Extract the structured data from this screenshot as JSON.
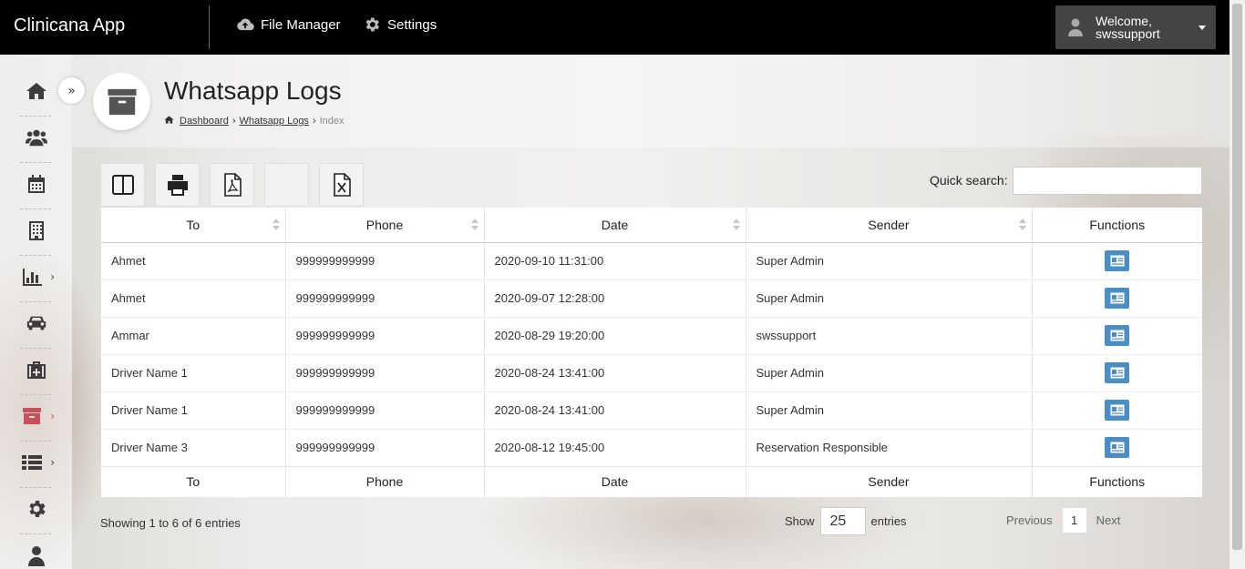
{
  "app": {
    "brand": "Clinicana App"
  },
  "topnav": [
    {
      "label": "File Manager",
      "icon": "cloud-upload-icon"
    },
    {
      "label": "Settings",
      "icon": "gear-icon"
    }
  ],
  "user": {
    "welcome": "Welcome,",
    "name": "swssupport"
  },
  "sidebar": {
    "items": [
      {
        "icon": "home-icon"
      },
      {
        "icon": "users-icon"
      },
      {
        "icon": "calendar-icon"
      },
      {
        "icon": "building-icon"
      },
      {
        "icon": "bar-chart-icon",
        "has_submenu": true
      },
      {
        "icon": "car-icon"
      },
      {
        "icon": "medkit-icon"
      },
      {
        "icon": "archive-icon",
        "has_submenu": true,
        "active": true
      },
      {
        "icon": "list-icon",
        "has_submenu": true
      },
      {
        "icon": "gear-icon"
      },
      {
        "icon": "user-icon"
      }
    ]
  },
  "page": {
    "title": "Whatsapp Logs",
    "breadcrumb": [
      {
        "label": "Dashboard",
        "link": true
      },
      {
        "label": "Whatsapp Logs",
        "link": true
      },
      {
        "label": "Index",
        "link": false
      }
    ],
    "separator": "›"
  },
  "toolbar": {
    "buttons": [
      "columns-icon",
      "print-icon",
      "pdf-icon",
      "blank",
      "excel-icon"
    ],
    "search_label": "Quick search:",
    "search_value": ""
  },
  "table": {
    "columns": [
      "To",
      "Phone",
      "Date",
      "Sender",
      "Functions"
    ],
    "rows": [
      {
        "to": "Ahmet",
        "phone": "999999999999",
        "date": "2020-09-10 11:31:00",
        "sender": "Super Admin"
      },
      {
        "to": "Ahmet",
        "phone": "999999999999",
        "date": "2020-09-07 12:28:00",
        "sender": "Super Admin"
      },
      {
        "to": "Ammar",
        "phone": "999999999999",
        "date": "2020-08-29 19:20:00",
        "sender": "swssupport"
      },
      {
        "to": "Driver Name 1",
        "phone": "999999999999",
        "date": "2020-08-24 13:41:00",
        "sender": "Super Admin"
      },
      {
        "to": "Driver Name 1",
        "phone": "999999999999",
        "date": "2020-08-24 13:41:00",
        "sender": "Super Admin"
      },
      {
        "to": "Driver Name 3",
        "phone": "999999999999",
        "date": "2020-08-12 19:45:00",
        "sender": "Reservation Responsible"
      }
    ]
  },
  "footer": {
    "info": "Showing 1 to 6 of 6 entries",
    "show_label": "Show",
    "page_length": "25",
    "entries_label": "entries",
    "prev": "Previous",
    "current_page": "1",
    "next": "Next"
  },
  "colors": {
    "accent": "#4a8ec5",
    "active_sidebar": "#c8505a",
    "topbar": "#000000"
  }
}
